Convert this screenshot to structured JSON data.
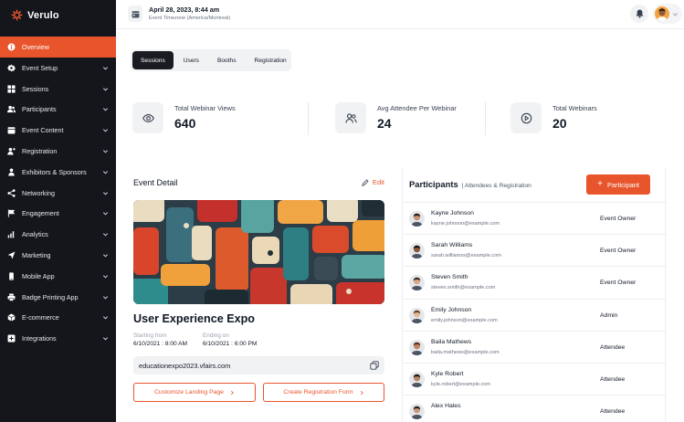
{
  "brand": {
    "name": "Verulo",
    "accent": "#e8552d"
  },
  "sidebar": {
    "items": [
      {
        "label": "Overview",
        "icon": "info-icon",
        "active": true
      },
      {
        "label": "Event Setup",
        "icon": "gear-star-icon"
      },
      {
        "label": "Sessions",
        "icon": "grid-icon"
      },
      {
        "label": "Participants",
        "icon": "users-icon"
      },
      {
        "label": "Event Content",
        "icon": "calendar-icon"
      },
      {
        "label": "Registration",
        "icon": "user-plus-icon"
      },
      {
        "label": "Exhibitors & Sponsors",
        "icon": "person-icon"
      },
      {
        "label": "Networking",
        "icon": "share-icon"
      },
      {
        "label": "Engagement",
        "icon": "flag-icon"
      },
      {
        "label": "Analytics",
        "icon": "bars-icon"
      },
      {
        "label": "Marketing",
        "icon": "send-icon"
      },
      {
        "label": "Mobile App",
        "icon": "phone-icon"
      },
      {
        "label": "Badge Printing App",
        "icon": "printer-icon"
      },
      {
        "label": "E-commerce",
        "icon": "cube-icon"
      },
      {
        "label": "Integrations",
        "icon": "plus-square-icon"
      }
    ]
  },
  "topbar": {
    "date": "April 28, 2023, 8:44 am",
    "timezone": "Event Timezone (America/Montreal)"
  },
  "tabs": [
    "Sessions",
    "Users",
    "Booths",
    "Registration"
  ],
  "stats": [
    {
      "label": "Total Webinar Views",
      "value": "640",
      "icon": "eye-icon"
    },
    {
      "label": "Avg Attendee Per Webinar",
      "value": "24",
      "icon": "users-icon"
    },
    {
      "label": "Total Webinars",
      "value": "20",
      "icon": "play-circle-icon"
    }
  ],
  "event": {
    "section_title": "Event Detail",
    "edit_label": "Edit",
    "name": "User Experience Expo",
    "start_label": "Starting from",
    "start_value": "6/10/2021 : 8:00 AM",
    "end_label": "Ending on",
    "end_value": "6/10/2021 : 6:00 PM",
    "url": "educationexpo2023.vfairs.com",
    "btn_landing": "Customize Landing Page",
    "btn_registration": "Create Registration Form"
  },
  "participants": {
    "title": "Participants",
    "subtitle": "Attendees & Registration",
    "add_label": "Participant",
    "rows": [
      {
        "name": "Kayne Johnson",
        "email": "kayne.johnson@example.com",
        "role": "Event Owner",
        "skin": "#c99572",
        "hair": "#2b1d14"
      },
      {
        "name": "Sarah Williams",
        "email": "sarah.williamss@example.com",
        "role": "Event Owner",
        "skin": "#8a5a3c",
        "hair": "#1a120c"
      },
      {
        "name": "Steven Smith",
        "email": "steven.smith@example.com",
        "role": "Event Owner",
        "skin": "#d7a987",
        "hair": "#3a2a20"
      },
      {
        "name": "Emily Johnson",
        "email": "emily.johnson@example.com",
        "role": "Admin",
        "skin": "#e4b894",
        "hair": "#6b3f24"
      },
      {
        "name": "Baila Mathews",
        "email": "baila.mathews@example.com",
        "role": "Attendee",
        "skin": "#c08764",
        "hair": "#5a2f1c"
      },
      {
        "name": "Kyle Robert",
        "email": "kyle.robert@example.com",
        "role": "Attendee",
        "skin": "#b98464",
        "hair": "#231a14"
      },
      {
        "name": "Alex Hales",
        "email": "",
        "role": "Attendee",
        "skin": "#c9967a",
        "hair": "#2e2018"
      }
    ]
  }
}
